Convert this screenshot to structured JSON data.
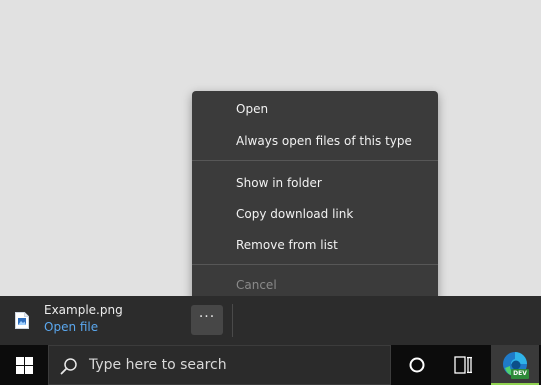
{
  "context_menu": {
    "items": [
      {
        "label": "Open"
      },
      {
        "label": "Always open files of this type"
      },
      {
        "label": "Show in folder"
      },
      {
        "label": "Copy download link"
      },
      {
        "label": "Remove from list"
      },
      {
        "label": "Cancel",
        "disabled": true
      }
    ]
  },
  "download_bar": {
    "file_name": "Example.png",
    "open_link": "Open file",
    "more_button": "···",
    "file_icon": "image-file-icon"
  },
  "taskbar": {
    "start_icon": "windows-logo-icon",
    "search_placeholder": "Type here to search",
    "cortana_icon": "cortana-circle-icon",
    "task_view_icon": "task-view-icon",
    "edge_icon": "edge-dev-icon",
    "edge_badge": "DEV"
  },
  "colors": {
    "menu_background": "#3b3b3b",
    "link": "#5aa7ee",
    "disabled_text": "#8a8a8a",
    "taskbar": "#0c0c0c",
    "active_app_indicator": "#8fd14f"
  }
}
